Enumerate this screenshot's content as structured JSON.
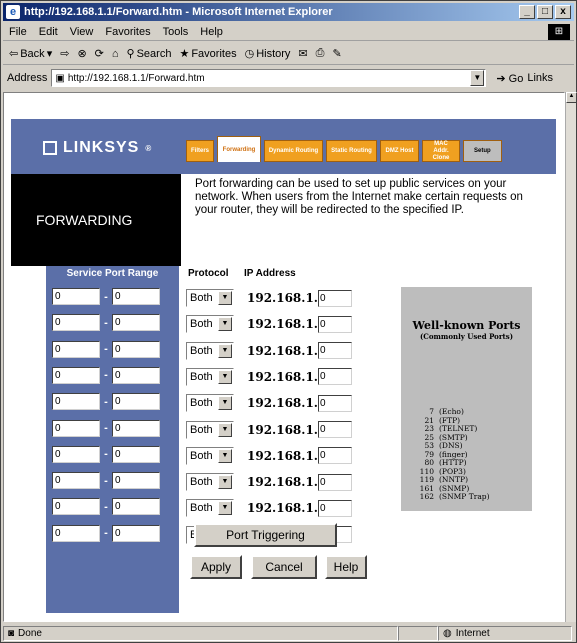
{
  "window": {
    "title": "http://192.168.1.1/Forward.htm - Microsoft Internet Explorer",
    "minimize": "_",
    "maximize": "□",
    "close": "x"
  },
  "menu": [
    "File",
    "Edit",
    "View",
    "Favorites",
    "Tools",
    "Help"
  ],
  "toolbar": {
    "back": "Back",
    "search": "Search",
    "favorites": "Favorites",
    "history": "History"
  },
  "address": {
    "label": "Address",
    "url": "http://192.168.1.1/Forward.htm",
    "go": "Go",
    "links": "Links"
  },
  "status": {
    "text": "Done",
    "zone": "Internet"
  },
  "page": {
    "brand": "LINKSYS",
    "tabs": [
      {
        "label": "Filters"
      },
      {
        "label": "Forwarding"
      },
      {
        "label": "Dynamic Routing"
      },
      {
        "label": "Static Routing"
      },
      {
        "label": "DMZ Host"
      },
      {
        "label": "MAC Addr. Clone"
      },
      {
        "label": "Setup"
      }
    ],
    "section_title": "FORWARDING",
    "description": "Port forwarding can be used to set up public services on your network. When users from the Internet make certain requests on your router, they will be redirected to the specified IP.",
    "col_service": "Service Port Range",
    "col_protocol": "Protocol",
    "col_ip": "IP Address",
    "rows": [
      {
        "start": "0",
        "end": "0",
        "protocol": "Both",
        "ip_prefix": "192.168.1.",
        "ip_last": "0"
      },
      {
        "start": "0",
        "end": "0",
        "protocol": "Both",
        "ip_prefix": "192.168.1.",
        "ip_last": "0"
      },
      {
        "start": "0",
        "end": "0",
        "protocol": "Both",
        "ip_prefix": "192.168.1.",
        "ip_last": "0"
      },
      {
        "start": "0",
        "end": "0",
        "protocol": "Both",
        "ip_prefix": "192.168.1.",
        "ip_last": "0"
      },
      {
        "start": "0",
        "end": "0",
        "protocol": "Both",
        "ip_prefix": "192.168.1.",
        "ip_last": "0"
      },
      {
        "start": "0",
        "end": "0",
        "protocol": "Both",
        "ip_prefix": "192.168.1.",
        "ip_last": "0"
      },
      {
        "start": "0",
        "end": "0",
        "protocol": "Both",
        "ip_prefix": "192.168.1.",
        "ip_last": "0"
      },
      {
        "start": "0",
        "end": "0",
        "protocol": "Both",
        "ip_prefix": "192.168.1.",
        "ip_last": "0"
      },
      {
        "start": "0",
        "end": "0",
        "protocol": "Both",
        "ip_prefix": "192.168.1.",
        "ip_last": "0"
      },
      {
        "start": "0",
        "end": "0",
        "protocol": "Both",
        "ip_prefix": "192.168.1.",
        "ip_last": "0"
      }
    ],
    "well_known_title": "Well-known Ports",
    "well_known_subtitle": "(Commonly Used Ports)",
    "well_known": [
      {
        "port": "7",
        "name": "(Echo)"
      },
      {
        "port": "21",
        "name": "(FTP)"
      },
      {
        "port": "23",
        "name": "(TELNET)"
      },
      {
        "port": "25",
        "name": "(SMTP)"
      },
      {
        "port": "53",
        "name": "(DNS)"
      },
      {
        "port": "79",
        "name": "(finger)"
      },
      {
        "port": "80",
        "name": "(HTTP)"
      },
      {
        "port": "110",
        "name": "(POP3)"
      },
      {
        "port": "119",
        "name": "(NNTP)"
      },
      {
        "port": "161",
        "name": "(SNMP)"
      },
      {
        "port": "162",
        "name": "(SNMP Trap)"
      }
    ],
    "buttons": {
      "port_triggering": "Port Triggering",
      "apply": "Apply",
      "cancel": "Cancel",
      "help": "Help"
    }
  }
}
